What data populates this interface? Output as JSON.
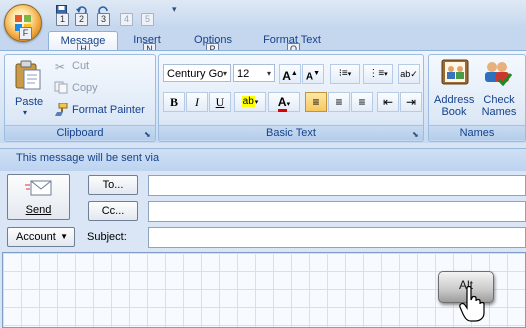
{
  "quick_access": {
    "keytips": [
      "1",
      "2",
      "3",
      "4",
      "5"
    ]
  },
  "tabs": [
    {
      "label": "Message",
      "keytip": "H"
    },
    {
      "label": "Insert",
      "keytip": "N"
    },
    {
      "label": "Options",
      "keytip": "P"
    },
    {
      "label": "Format Text",
      "keytip": "O"
    }
  ],
  "clipboard": {
    "group_label": "Clipboard",
    "paste_label": "Paste",
    "cut_label": "Cut",
    "copy_label": "Copy",
    "format_painter_label": "Format Painter"
  },
  "basic_text": {
    "group_label": "Basic Text",
    "font_name": "Century Go",
    "font_size": "12",
    "grow_glyph": "A",
    "shrink_glyph": "A",
    "bold": "B",
    "italic": "I",
    "underline": "U",
    "highlight_glyph": "ab",
    "font_color_glyph": "A"
  },
  "names": {
    "group_label": "Names",
    "address_book_label": "Address Book",
    "check_names_label": "Check Names"
  },
  "info_bar": {
    "text": "This message will be sent via"
  },
  "compose": {
    "send_label": "Send",
    "to_label": "To...",
    "cc_label": "Cc...",
    "account_label": "Account",
    "subject_label": "Subject:"
  },
  "overlay": {
    "key_label": "Alt"
  },
  "colors": {
    "ribbon": "#d7e4f4",
    "accent": "#15428b",
    "highlight_yellow": "#ffff00",
    "font_red": "#e00000"
  }
}
